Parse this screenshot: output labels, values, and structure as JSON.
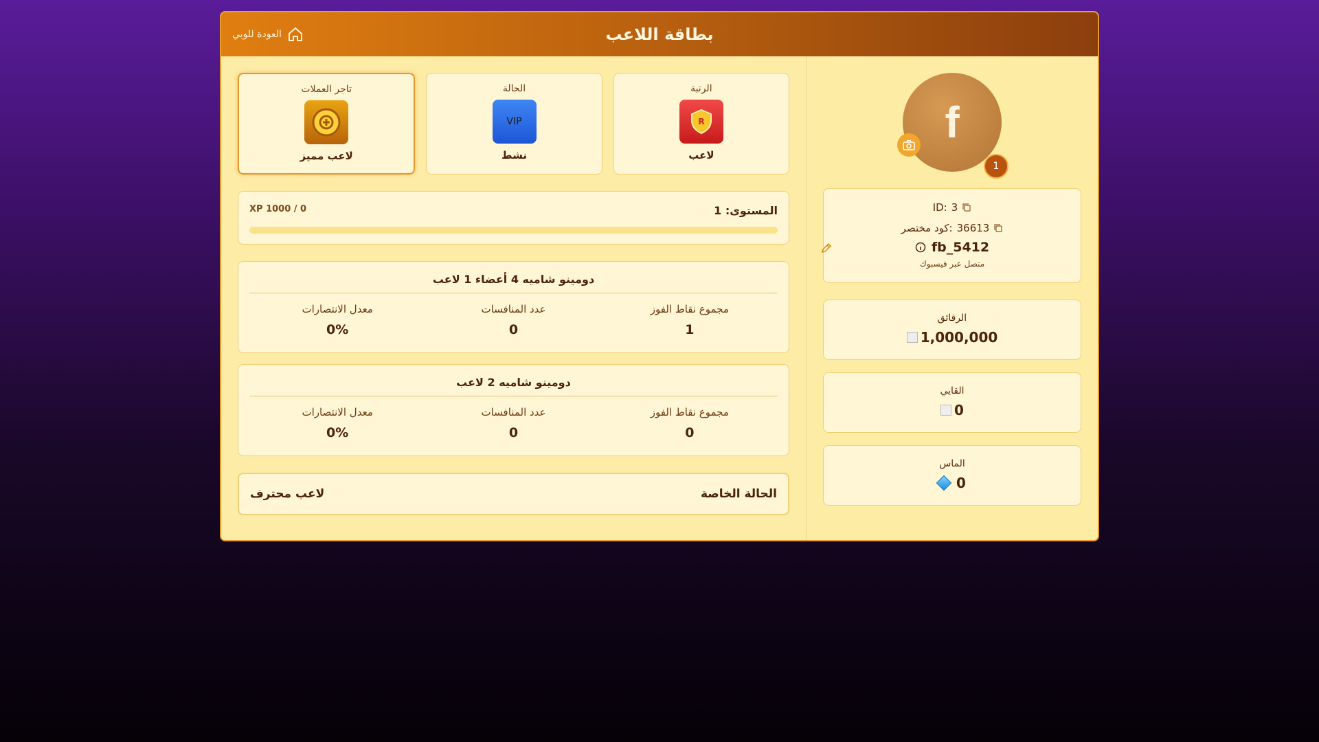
{
  "header": {
    "title": "بطاقة اللاعب",
    "back_label": "العودة للوبي"
  },
  "cards": [
    {
      "label": "الرتبة",
      "value": "لاعب",
      "icon_text": "R"
    },
    {
      "label": "الحالة",
      "value": "نشط",
      "icon_text": "VIP"
    },
    {
      "label": "تاجر العملات",
      "value": "لاعب مميز"
    }
  ],
  "level": {
    "label": "المستوى: 1",
    "xp": "XP 1000 / 0",
    "progress": 0
  },
  "games": [
    {
      "title": "دومينو شاميه 4 أعضاء 1 لاعب",
      "stats": [
        {
          "k": "مجموع نقاط الفوز",
          "v": "1"
        },
        {
          "k": "عدد المنافسات",
          "v": "0"
        },
        {
          "k": "معدل الانتصارات",
          "v": "0%"
        }
      ]
    },
    {
      "title": "دومينو شاميه 2 لاعب",
      "stats": [
        {
          "k": "مجموع نقاط الفوز",
          "v": "0"
        },
        {
          "k": "عدد المنافسات",
          "v": "0"
        },
        {
          "k": "معدل الانتصارات",
          "v": "0%"
        }
      ]
    }
  ],
  "special": {
    "label": "الحالة الخاصة",
    "value": "لاعب محترف"
  },
  "profile": {
    "avatar_letter": "f",
    "level_badge": "1",
    "id_label": "ID:",
    "id_value": "3",
    "short_code_label": "كود مختصر:",
    "short_code_value": "36613",
    "name": "fb_5412",
    "connected_via": "متصل عبر فيسبوك"
  },
  "currencies": [
    {
      "label": "الرقائق",
      "value": "1,000,000"
    },
    {
      "label": "القايي",
      "value": "0"
    },
    {
      "label": "الماس",
      "value": "0"
    }
  ]
}
